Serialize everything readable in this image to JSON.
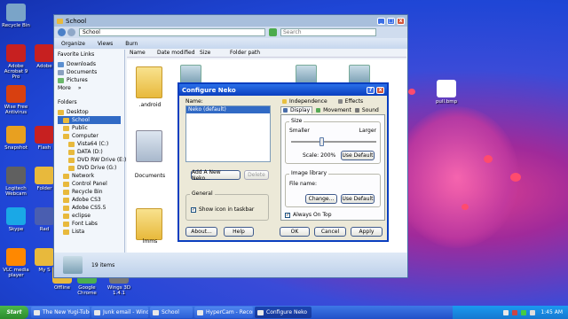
{
  "desktop_icons": [
    {
      "label": "Recycle Bin",
      "color": "#7aa4c8"
    },
    {
      "label": "Adobe Acrobat 9 Pro",
      "color": "#c72020"
    },
    {
      "label": "Wise Free Antivirus",
      "color": "#d84010"
    },
    {
      "label": "Snapshot",
      "color": "#e8a020"
    },
    {
      "label": "Logitech Webcam",
      "color": "#606060"
    },
    {
      "label": "Skype",
      "color": "#1aa8e6"
    },
    {
      "label": "VLC media player",
      "color": "#ff8800"
    },
    {
      "label": "Adobe",
      "color": "#c72020"
    },
    {
      "label": "Flash",
      "color": "#c72020"
    },
    {
      "label": "Folder",
      "color": "#e8b93c"
    },
    {
      "label": "Rad",
      "color": "#4a5eb0"
    },
    {
      "label": "My S",
      "color": "#e8b93c"
    },
    {
      "label": "Offline",
      "color": "#e8b93c"
    },
    {
      "label": "Google Chrome",
      "color": "#4caf50"
    },
    {
      "label": "Wings 3D 1.4.1",
      "color": "#777777"
    },
    {
      "label": "pull.bmp",
      "color": "#ffffff"
    }
  ],
  "explorer": {
    "title": "School",
    "address": "School",
    "search_placeholder": "Search",
    "toolbar": [
      "Organize",
      "Views",
      "Burn"
    ],
    "columns": [
      "Name",
      "Date modified",
      "Size",
      "Folder path"
    ],
    "favorites_title": "Favorite Links",
    "favorites": [
      "Downloads",
      "Documents",
      "Pictures",
      "More"
    ],
    "favorites_more_glyph": "»",
    "folders_title": "Folders",
    "tree": [
      "Desktop",
      "School",
      "Public",
      "Computer",
      "Vista64 (C:)",
      "DATA (D:)",
      "DVD RW Drive (E:)",
      "DVD Drive (G:)",
      "Network",
      "Control Panel",
      "Recycle Bin",
      "Adobe CS3",
      "Adobe CS5.5",
      "eclipse",
      "Font Labs",
      "Lista"
    ],
    "files": [
      ".android",
      "Documents",
      "lmms"
    ],
    "status": "19 items"
  },
  "dialog": {
    "title": "Configure Neko",
    "help_glyph": "?",
    "close_glyph": "x",
    "name_label": "Name:",
    "name_value": "Neko (default)",
    "list_items": [
      "Neko (default)"
    ],
    "add_button": "Add A New Neko...",
    "delete_button": "Delete",
    "general_title": "General",
    "show_icon_label": "Show icon in taskbar",
    "show_icon_checked": true,
    "about_button": "About...",
    "help_button": "Help",
    "tabs": [
      "Independence",
      "Effects",
      "Display",
      "Movement",
      "Sound"
    ],
    "size_title": "Size",
    "smaller_label": "Smaller",
    "larger_label": "Larger",
    "scale_label": "Scale: 200%",
    "slider_level": 0.35,
    "size_default_button": "Use Default",
    "image_title": "Image library",
    "file_name_label": "File name:",
    "change_button": "Change...",
    "image_default_button": "Use Default",
    "always_on_top_label": "Always On Top",
    "always_on_top_checked": true,
    "ok_button": "OK",
    "cancel_button": "Cancel",
    "apply_button": "Apply"
  },
  "taskbar": {
    "start_label": "Start",
    "items": [
      "The New Yugi-Tube Elite ...",
      "Junk email - Windows Liv...",
      "School",
      "HyperCam - Recording",
      "Configure Neko"
    ],
    "clock": "1:45 AM"
  },
  "colors": {
    "titlebar_active": "#0a54d6",
    "dialog_bg": "#ece9d8",
    "taskbar": "#2a5ad8",
    "start": "#3c9a3c",
    "selection": "#316ac5"
  }
}
